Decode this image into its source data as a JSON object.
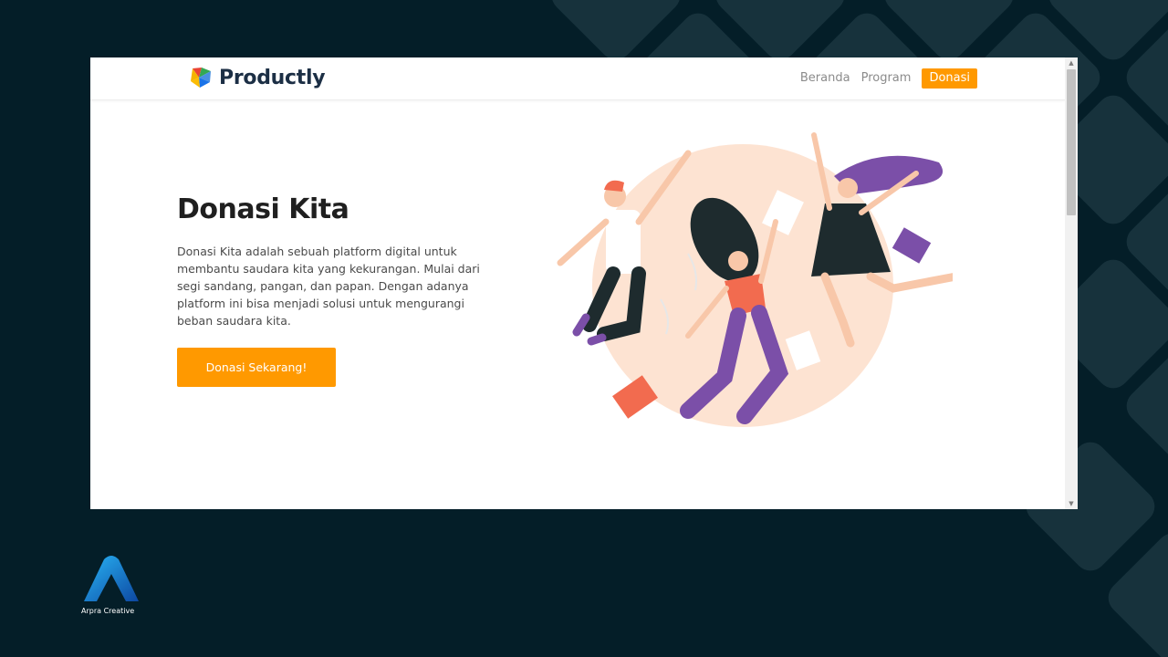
{
  "site": {
    "brand": "Productly",
    "nav": [
      {
        "label": "Beranda",
        "active": false
      },
      {
        "label": "Program",
        "active": false
      },
      {
        "label": "Donasi",
        "active": true
      }
    ]
  },
  "hero": {
    "title": "Donasi Kita",
    "description": "Donasi Kita adalah sebuah platform digital untuk membantu saudara kita yang kekurangan. Mulai dari segi sandang, pangan, dan papan. Dengan adanya platform ini bisa menjadi solusi untuk mengurangi beban saudara kita.",
    "cta_label": "Donasi Sekarang!"
  },
  "watermark": {
    "name": "Arpra Creative"
  },
  "colors": {
    "accent": "#ff9900",
    "background": "#041e28",
    "brand_text": "#1c2f45"
  }
}
